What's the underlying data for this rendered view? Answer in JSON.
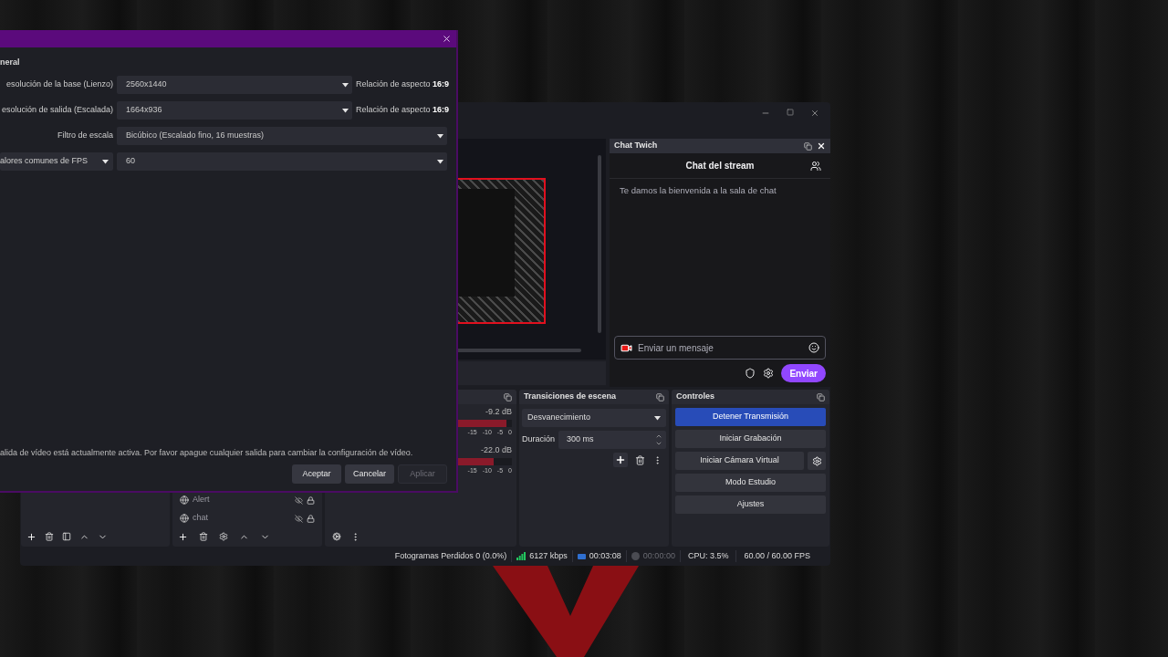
{
  "settings_dialog": {
    "section_title": "neral",
    "rows": [
      {
        "kind": "combo",
        "label": "esolución de la base (Lienzo)",
        "value": "2560x1440",
        "aspect_label": "Relación de aspecto",
        "aspect_value": "16:9"
      },
      {
        "kind": "combo",
        "label": "esolución de salida (Escalada)",
        "value": "1664x936",
        "aspect_label": "Relación de aspecto",
        "aspect_value": "16:9"
      },
      {
        "kind": "select",
        "label": "Filtro de escala",
        "value": "Bicúbico (Escalado fino, 16 muestras)"
      },
      {
        "kind": "label_select",
        "label": "alores comunes de FPS",
        "value": "60"
      }
    ],
    "warning": "alida de vídeo está actualmente activa. Por favor apague cualquier salida para cambiar la configuración de vídeo.",
    "buttons": [
      {
        "label": "Aceptar",
        "disabled": false
      },
      {
        "label": "Cancelar",
        "disabled": false
      },
      {
        "label": "Aplicar",
        "disabled": true
      }
    ]
  },
  "main_window": {
    "chat": {
      "title": "Chat Twich",
      "header": "Chat del stream",
      "welcome": "Te damos la bienvenida a la sala de chat",
      "placeholder": "Enviar un mensaje",
      "send": "Enviar"
    },
    "sources": [
      {
        "name": "Alert"
      },
      {
        "name": "chat"
      }
    ],
    "mixer": {
      "channels": [
        {
          "reading": "-9.2 dB",
          "level": 0.97,
          "ticks": [
            "-15",
            "-10",
            "-5",
            "0"
          ]
        },
        {
          "reading": "-22.0 dB",
          "level": 0.9,
          "ticks": [
            "-15",
            "-10",
            "-5",
            "0"
          ]
        }
      ]
    },
    "transitions": {
      "title": "Transiciones de escena",
      "value": "Desvanecimiento",
      "duration_label": "Duración",
      "duration": "300 ms"
    },
    "controls": {
      "title": "Controles",
      "buttons": [
        {
          "kind": "plain",
          "label": "Detener Transmisión",
          "selected": true
        },
        {
          "kind": "plain",
          "label": "Iniciar Grabación",
          "selected": false
        },
        {
          "kind": "with_settings",
          "label": "Iniciar Cámara Virtual",
          "selected": false
        },
        {
          "kind": "plain",
          "label": "Modo Estudio",
          "selected": false
        },
        {
          "kind": "plain",
          "label": "Ajustes",
          "selected": false
        }
      ]
    },
    "status_bar": {
      "dropped_frames": "Fotogramas Perdidos 0 (0.0%)",
      "bitrate": "6127 kbps",
      "stream_time": "00:03:08",
      "streaming": true,
      "record_time": "00:00:00",
      "recording": false,
      "cpu": "CPU: 3.5%",
      "fps": "60.00 / 60.00 FPS"
    }
  }
}
